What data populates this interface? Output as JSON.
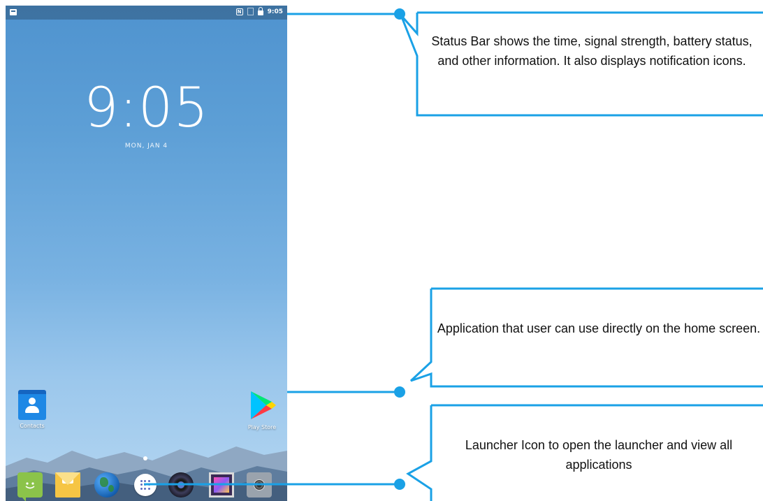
{
  "status_bar": {
    "time": "9:05"
  },
  "lock_clock": {
    "time": "9:05",
    "date": "MON, JAN 4"
  },
  "home_apps": {
    "contacts_label": "Contacts",
    "playstore_label": "Play Store"
  },
  "callouts": {
    "status_bar": "Status Bar shows the time, signal strength, battery status, and other information. It also displays notification icons.",
    "home_app": "Application that user can use directly on the home screen.",
    "launcher": "Launcher Icon to open the launcher and view all applications"
  },
  "colors": {
    "callout_accent": "#1aa1e6"
  }
}
